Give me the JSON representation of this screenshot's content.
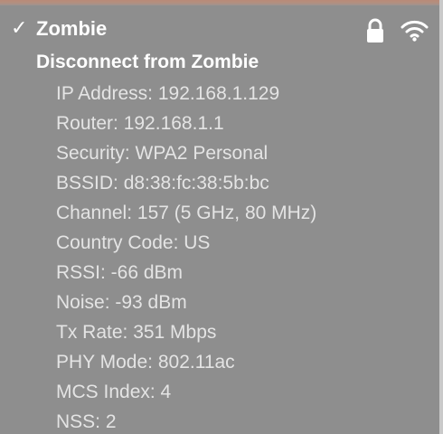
{
  "network": {
    "name": "Zombie",
    "connected_mark": "✓",
    "secured": true,
    "icons": [
      "checkmark-icon",
      "lock-icon",
      "wifi-icon"
    ]
  },
  "actions": {
    "disconnect_label": "Disconnect from Zombie"
  },
  "details": [
    "IP Address: 192.168.1.129",
    "Router: 192.168.1.1",
    "Security: WPA2 Personal",
    "BSSID: d8:38:fc:38:5b:bc",
    "Channel: 157 (5 GHz, 80 MHz)",
    "Country Code: US",
    "RSSI: -66 dBm",
    "Noise: -93 dBm",
    "Tx Rate: 351 Mbps",
    "PHY Mode: 802.11ac",
    "MCS Index: 4",
    "NSS: 2"
  ],
  "colors": {
    "menu_background": "#8e8e8e",
    "primary_text": "#ffffff",
    "secondary_text": "#e4e4e4"
  }
}
